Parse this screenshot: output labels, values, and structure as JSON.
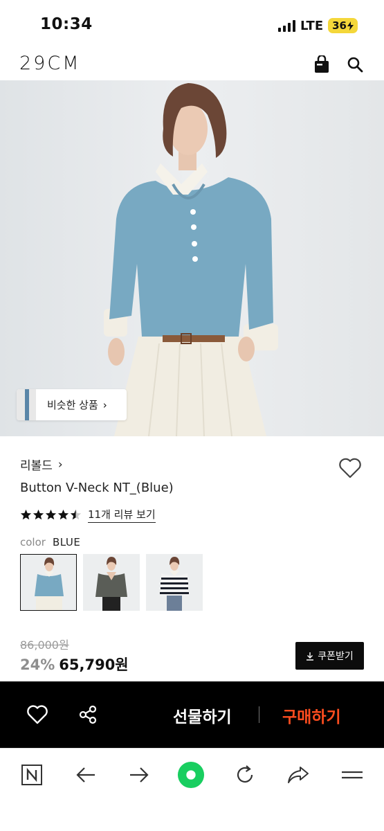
{
  "status_bar": {
    "time": "10:34",
    "network": "LTE",
    "battery": "36"
  },
  "header": {
    "logo": "29CM",
    "icons": [
      "shopping-bag-icon",
      "search-icon"
    ]
  },
  "hero": {
    "similar_products_label": "비슷한 상품",
    "similar_chevron": "›"
  },
  "product": {
    "brand": "리볼드",
    "brand_chevron": "›",
    "name": "Button V-Neck NT_(Blue)",
    "rating_stars": 4.5,
    "review_link": "11개 리뷰 보기",
    "color_label": "color",
    "color_value": "BLUE",
    "swatches": [
      "blue",
      "gray",
      "navy-stripe"
    ],
    "original_price": "86,000원",
    "discount": "24%",
    "price": "65,790원",
    "coupon_button": "쿠폰받기"
  },
  "purchase_bar": {
    "gift_label": "선물하기",
    "buy_label": "구매하기",
    "accent_color": "#ff4d1f"
  },
  "browser_toolbar": {
    "icons": [
      "naver-n-icon",
      "back-arrow-icon",
      "forward-arrow-icon",
      "home-green-circle-icon",
      "reload-icon",
      "share-icon",
      "menu-icon"
    ],
    "accent_color": "#19ce60"
  }
}
